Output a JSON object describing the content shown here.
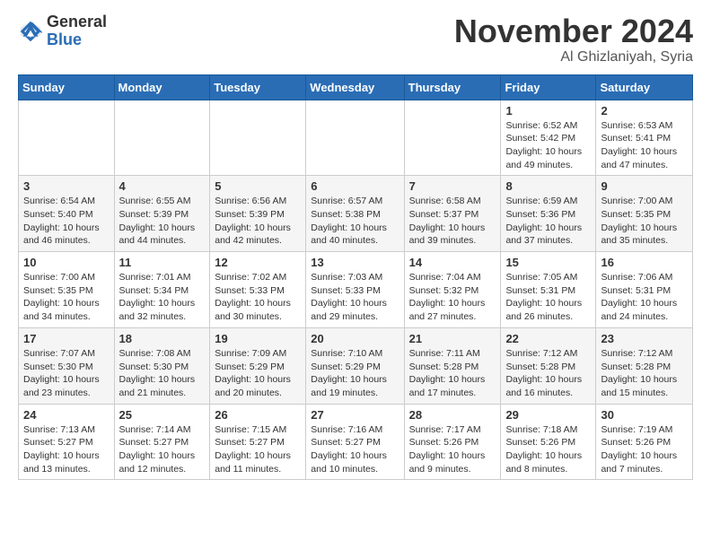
{
  "header": {
    "logo_general": "General",
    "logo_blue": "Blue",
    "title": "November 2024",
    "location": "Al Ghizlaniyah, Syria"
  },
  "weekdays": [
    "Sunday",
    "Monday",
    "Tuesday",
    "Wednesday",
    "Thursday",
    "Friday",
    "Saturday"
  ],
  "rows": [
    [
      {
        "day": "",
        "info": ""
      },
      {
        "day": "",
        "info": ""
      },
      {
        "day": "",
        "info": ""
      },
      {
        "day": "",
        "info": ""
      },
      {
        "day": "",
        "info": ""
      },
      {
        "day": "1",
        "info": "Sunrise: 6:52 AM\nSunset: 5:42 PM\nDaylight: 10 hours\nand 49 minutes."
      },
      {
        "day": "2",
        "info": "Sunrise: 6:53 AM\nSunset: 5:41 PM\nDaylight: 10 hours\nand 47 minutes."
      }
    ],
    [
      {
        "day": "3",
        "info": "Sunrise: 6:54 AM\nSunset: 5:40 PM\nDaylight: 10 hours\nand 46 minutes."
      },
      {
        "day": "4",
        "info": "Sunrise: 6:55 AM\nSunset: 5:39 PM\nDaylight: 10 hours\nand 44 minutes."
      },
      {
        "day": "5",
        "info": "Sunrise: 6:56 AM\nSunset: 5:39 PM\nDaylight: 10 hours\nand 42 minutes."
      },
      {
        "day": "6",
        "info": "Sunrise: 6:57 AM\nSunset: 5:38 PM\nDaylight: 10 hours\nand 40 minutes."
      },
      {
        "day": "7",
        "info": "Sunrise: 6:58 AM\nSunset: 5:37 PM\nDaylight: 10 hours\nand 39 minutes."
      },
      {
        "day": "8",
        "info": "Sunrise: 6:59 AM\nSunset: 5:36 PM\nDaylight: 10 hours\nand 37 minutes."
      },
      {
        "day": "9",
        "info": "Sunrise: 7:00 AM\nSunset: 5:35 PM\nDaylight: 10 hours\nand 35 minutes."
      }
    ],
    [
      {
        "day": "10",
        "info": "Sunrise: 7:00 AM\nSunset: 5:35 PM\nDaylight: 10 hours\nand 34 minutes."
      },
      {
        "day": "11",
        "info": "Sunrise: 7:01 AM\nSunset: 5:34 PM\nDaylight: 10 hours\nand 32 minutes."
      },
      {
        "day": "12",
        "info": "Sunrise: 7:02 AM\nSunset: 5:33 PM\nDaylight: 10 hours\nand 30 minutes."
      },
      {
        "day": "13",
        "info": "Sunrise: 7:03 AM\nSunset: 5:33 PM\nDaylight: 10 hours\nand 29 minutes."
      },
      {
        "day": "14",
        "info": "Sunrise: 7:04 AM\nSunset: 5:32 PM\nDaylight: 10 hours\nand 27 minutes."
      },
      {
        "day": "15",
        "info": "Sunrise: 7:05 AM\nSunset: 5:31 PM\nDaylight: 10 hours\nand 26 minutes."
      },
      {
        "day": "16",
        "info": "Sunrise: 7:06 AM\nSunset: 5:31 PM\nDaylight: 10 hours\nand 24 minutes."
      }
    ],
    [
      {
        "day": "17",
        "info": "Sunrise: 7:07 AM\nSunset: 5:30 PM\nDaylight: 10 hours\nand 23 minutes."
      },
      {
        "day": "18",
        "info": "Sunrise: 7:08 AM\nSunset: 5:30 PM\nDaylight: 10 hours\nand 21 minutes."
      },
      {
        "day": "19",
        "info": "Sunrise: 7:09 AM\nSunset: 5:29 PM\nDaylight: 10 hours\nand 20 minutes."
      },
      {
        "day": "20",
        "info": "Sunrise: 7:10 AM\nSunset: 5:29 PM\nDaylight: 10 hours\nand 19 minutes."
      },
      {
        "day": "21",
        "info": "Sunrise: 7:11 AM\nSunset: 5:28 PM\nDaylight: 10 hours\nand 17 minutes."
      },
      {
        "day": "22",
        "info": "Sunrise: 7:12 AM\nSunset: 5:28 PM\nDaylight: 10 hours\nand 16 minutes."
      },
      {
        "day": "23",
        "info": "Sunrise: 7:12 AM\nSunset: 5:28 PM\nDaylight: 10 hours\nand 15 minutes."
      }
    ],
    [
      {
        "day": "24",
        "info": "Sunrise: 7:13 AM\nSunset: 5:27 PM\nDaylight: 10 hours\nand 13 minutes."
      },
      {
        "day": "25",
        "info": "Sunrise: 7:14 AM\nSunset: 5:27 PM\nDaylight: 10 hours\nand 12 minutes."
      },
      {
        "day": "26",
        "info": "Sunrise: 7:15 AM\nSunset: 5:27 PM\nDaylight: 10 hours\nand 11 minutes."
      },
      {
        "day": "27",
        "info": "Sunrise: 7:16 AM\nSunset: 5:27 PM\nDaylight: 10 hours\nand 10 minutes."
      },
      {
        "day": "28",
        "info": "Sunrise: 7:17 AM\nSunset: 5:26 PM\nDaylight: 10 hours\nand 9 minutes."
      },
      {
        "day": "29",
        "info": "Sunrise: 7:18 AM\nSunset: 5:26 PM\nDaylight: 10 hours\nand 8 minutes."
      },
      {
        "day": "30",
        "info": "Sunrise: 7:19 AM\nSunset: 5:26 PM\nDaylight: 10 hours\nand 7 minutes."
      }
    ]
  ]
}
